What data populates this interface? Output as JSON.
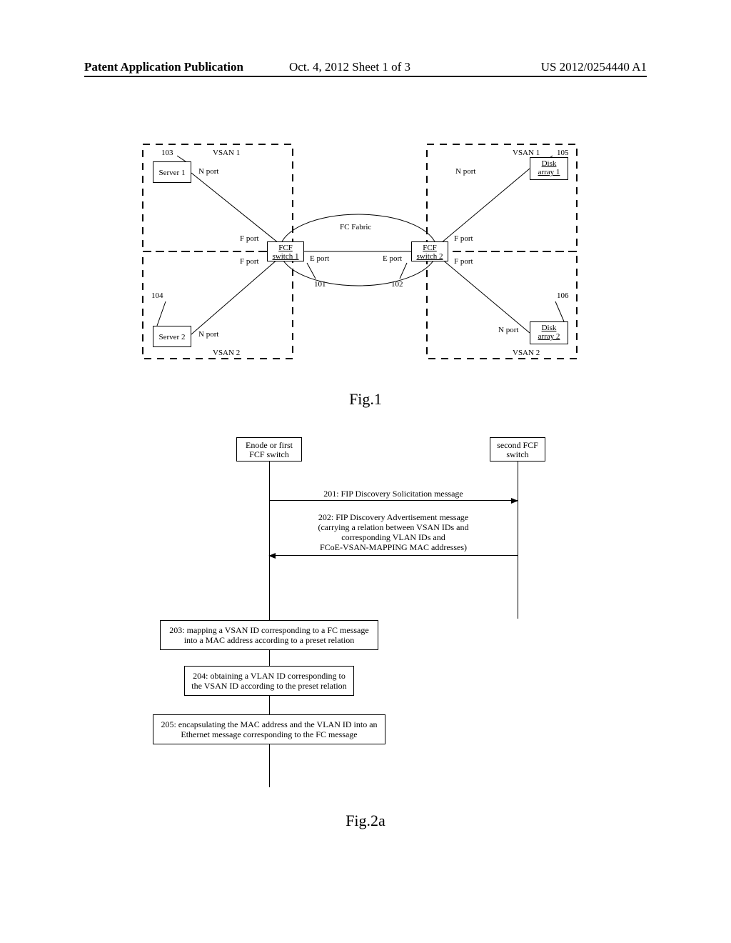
{
  "header": {
    "left": "Patent Application Publication",
    "mid": "Oct. 4, 2012   Sheet 1 of 3",
    "right": "US 2012/0254440 A1"
  },
  "fig1": {
    "caption": "Fig.1",
    "vsan1": "VSAN 1",
    "vsan2": "VSAN 2",
    "ref103": "103",
    "ref104": "104",
    "ref105": "105",
    "ref106": "106",
    "ref101": "101",
    "ref102": "102",
    "server1": "Server 1",
    "server2": "Server 2",
    "disk1a": "Disk",
    "disk1b": "array 1",
    "disk2a": "Disk",
    "disk2b": "array 2",
    "fcf1a": "FCF",
    "fcf1b": "switch 1",
    "fcf2a": "FCF",
    "fcf2b": "switch 2",
    "n_port": "N port",
    "f_port": "F port",
    "e_port": "E port",
    "fc_fabric": "FC Fabric"
  },
  "fig2": {
    "caption": "Fig.2a",
    "nodeA_l1": "Enode or",
    "nodeA_l2": "first FCF switch",
    "nodeB_l1": "second FCF",
    "nodeB_l2": "switch",
    "msg201": "201: FIP Discovery Solicitation message",
    "msg202_l1": "202: FIP Discovery Advertisement message",
    "msg202_l2": "(carrying a relation between VSAN IDs and",
    "msg202_l3": "corresponding VLAN IDs and",
    "msg202_l4": "FCoE-VSAN-MAPPING MAC addresses)",
    "step203": "203: mapping a VSAN ID corresponding to a FC message into a MAC address according to a preset relation",
    "step204": "204: obtaining a VLAN ID corresponding to the VSAN ID according to the preset relation",
    "step205": "205: encapsulating the MAC address and the VLAN ID into an Ethernet message corresponding to the FC message"
  }
}
